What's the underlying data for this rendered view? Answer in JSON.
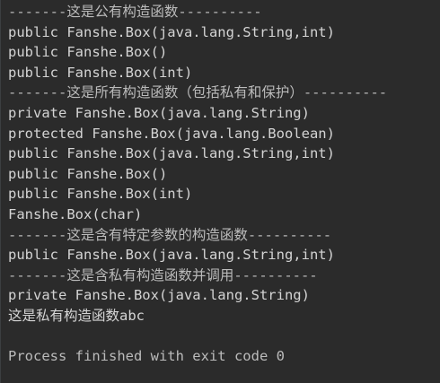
{
  "console": {
    "lines": [
      "-------这是公有构造函数----------",
      "public Fanshe.Box(java.lang.String,int)",
      "public Fanshe.Box()",
      "public Fanshe.Box(int)",
      "-------这是所有构造函数（包括私有和保护）----------",
      "private Fanshe.Box(java.lang.String)",
      "protected Fanshe.Box(java.lang.Boolean)",
      "public Fanshe.Box(java.lang.String,int)",
      "public Fanshe.Box()",
      "public Fanshe.Box(int)",
      "Fanshe.Box(char)",
      "-------这是含有特定参数的构造函数----------",
      "public Fanshe.Box(java.lang.String,int)",
      "-------这是含私有构造函数并调用----------",
      "private Fanshe.Box(java.lang.String)",
      "这是私有构造函数abc",
      "",
      "Process finished with exit code 0"
    ]
  },
  "colors": {
    "background": "#2b2b2b",
    "text": "#d4d4d4"
  }
}
